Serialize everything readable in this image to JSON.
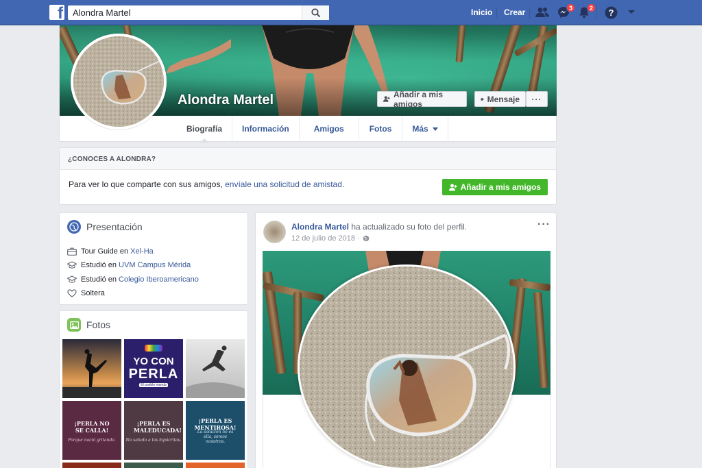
{
  "topbar": {
    "logo": "f",
    "search_value": "Alondra Martel",
    "nav": {
      "home": "Inicio",
      "create": "Crear"
    },
    "badges": {
      "messages": "3",
      "notifications": "2"
    },
    "icons": [
      "friends-icon",
      "messenger-icon",
      "bell-icon",
      "help-icon",
      "caret-down-icon"
    ]
  },
  "profile": {
    "name": "Alondra Martel",
    "add_friend": "Añadir a mis amigos",
    "message": "Mensaje",
    "more": "···",
    "tabs": [
      "Biografía",
      "Información",
      "Amigos",
      "Fotos",
      "Más"
    ]
  },
  "know": {
    "title": "¿CONOCES A ALONDRA?",
    "text": "Para ver lo que comparte con sus amigos, ",
    "link": "envíale una solicitud de amistad.",
    "button": "Añadir a mis amigos"
  },
  "intro": {
    "title": "Presentación",
    "rows": [
      {
        "icon": "briefcase-icon",
        "prefix": "Tour Guide en ",
        "link": "Xel-Ha"
      },
      {
        "icon": "graduation-cap-icon",
        "prefix": "Estudió en ",
        "link": "UVM Campus Mérida"
      },
      {
        "icon": "graduation-cap-icon",
        "prefix": "Estudió en ",
        "link": "Colegio Iberoamericano"
      },
      {
        "icon": "heart-icon",
        "prefix": "Soltera",
        "link": ""
      }
    ]
  },
  "photos": {
    "title": "Fotos",
    "tiles": {
      "t2_line1": "YO CON",
      "t2_line2": "PERLA",
      "t2_tag": "El pueblo manda",
      "t4_title": "¡PERLA NO SE CALLA!",
      "t4_sub": "Porque nació gritando.",
      "t5_title": "¡PERLA ES MALEDUCADA!",
      "t5_sub": "No saludo a los hipócritas.",
      "t6_title": "¡PERLA ES MENTIROSA!",
      "t6_sub": "La solución no es ella, somos nosotros."
    }
  },
  "post": {
    "author": "Alondra Martel",
    "action": " ha actualizado su foto del perfil.",
    "date": "12 de julio de 2018 · ",
    "more": "···"
  },
  "colors": {
    "brand": "#4267b2",
    "link": "#365899",
    "green": "#42b72a",
    "badge": "#fa3e3e"
  }
}
